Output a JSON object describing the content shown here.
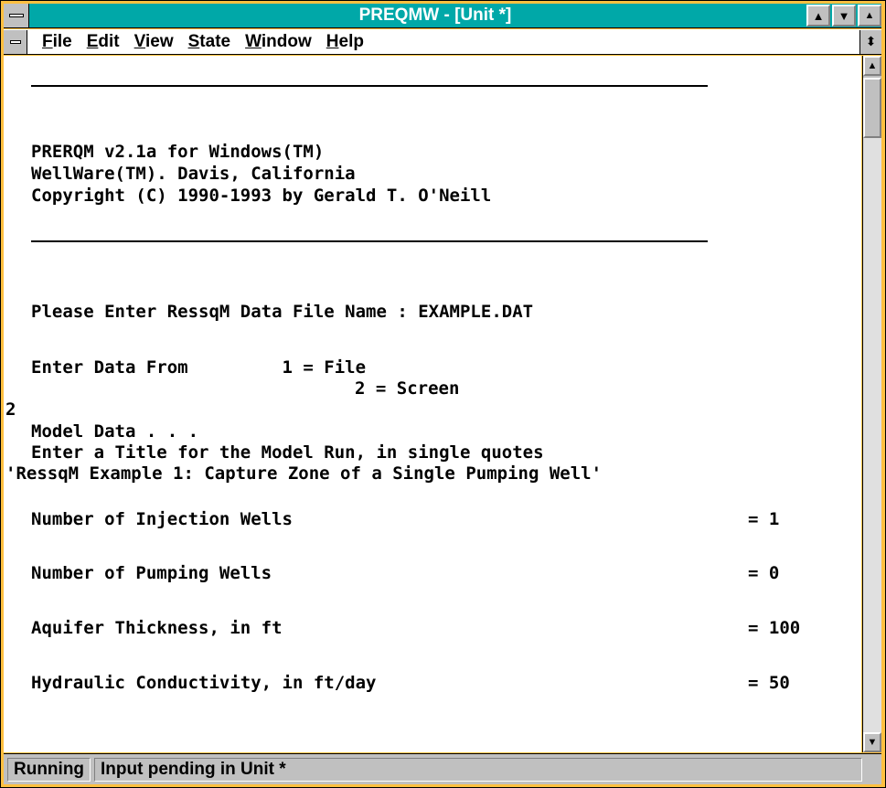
{
  "window": {
    "title": "PREQMW - [Unit *]"
  },
  "menu": {
    "items": [
      {
        "access": "F",
        "rest": "ile"
      },
      {
        "access": "E",
        "rest": "dit"
      },
      {
        "access": "V",
        "rest": "iew"
      },
      {
        "access": "S",
        "rest": "tate"
      },
      {
        "access": "W",
        "rest": "indow"
      },
      {
        "access": "H",
        "rest": "elp"
      }
    ]
  },
  "console": {
    "header1": "PRERQM v2.1a for Windows(TM)",
    "header2": "WellWare(TM). Davis, California",
    "header3": "Copyright (C) 1990-1993 by Gerald T. O'Neill",
    "prompt_file": "Please Enter RessqM Data File Name : EXAMPLE.DAT",
    "enter_from": "Enter Data From         1 = File",
    "enter_from2": "2 = Screen",
    "input_choice": "2",
    "model_data": "Model Data . . .",
    "title_prompt": "Enter a Title for the Model Run, in single quotes",
    "title_value": "'RessqM Example 1: Capture Zone of a Single Pumping Well'",
    "inj_label": "Number of Injection Wells",
    "inj_value": "= 1",
    "pump_label": "Number of Pumping Wells",
    "pump_value": "= 0",
    "thick_label": "Aquifer Thickness, in ft",
    "thick_value": "= 100",
    "cond_label": "Hydraulic Conductivity, in ft/day",
    "cond_value": "= 50"
  },
  "status": {
    "state": "Running",
    "message": "Input pending in Unit *"
  },
  "icons": {
    "maximize": "▲",
    "restore": "▼",
    "scroll_up": "▲",
    "scroll_down": "▼",
    "doc_restore": "⬍"
  }
}
